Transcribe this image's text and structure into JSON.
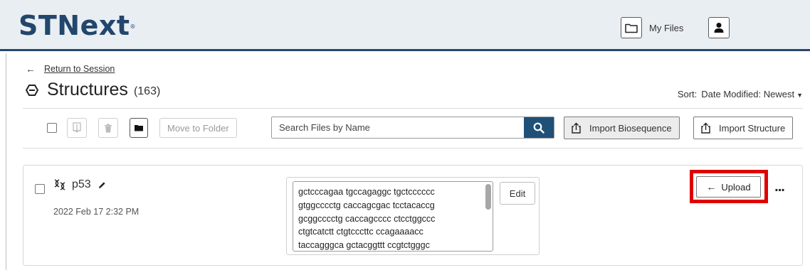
{
  "header": {
    "logo": "STNext",
    "logo_mark": "®",
    "my_files_label": "My Files",
    "folder_icon": "folder-icon",
    "user_icon": "user-icon"
  },
  "nav": {
    "back_label": "Return to Session"
  },
  "page": {
    "title": "Structures",
    "count": "(163)"
  },
  "sort": {
    "label": "Sort:",
    "value": "Date Modified: Newest"
  },
  "toolbar": {
    "move_to_folder_label": "Move to Folder"
  },
  "search": {
    "placeholder": "Search Files by Name"
  },
  "imports": {
    "biosequence_label": "Import Biosequence",
    "structure_label": "Import Structure"
  },
  "files": [
    {
      "name": "p53",
      "date": "2022 Feb 17 2:32 PM",
      "sequence_lines": [
        "gctcccagaa tgccagaggc tgctcccccc",
        "gtggcccctg caccagcgac tcctacaccg",
        "gcggcccctg caccagcccc ctcctggccc",
        "ctgtcatctt ctgtcccttc ccagaaaacc",
        "taccagggca gctacggttt ccgtctgggc"
      ],
      "edit_label": "Edit",
      "upload_label": "Upload",
      "more_label": "..."
    }
  ],
  "colors": {
    "brand": "#22466c",
    "header_bg": "#e9eef3",
    "search_button": "#1f5078",
    "highlight": "#e00000"
  }
}
